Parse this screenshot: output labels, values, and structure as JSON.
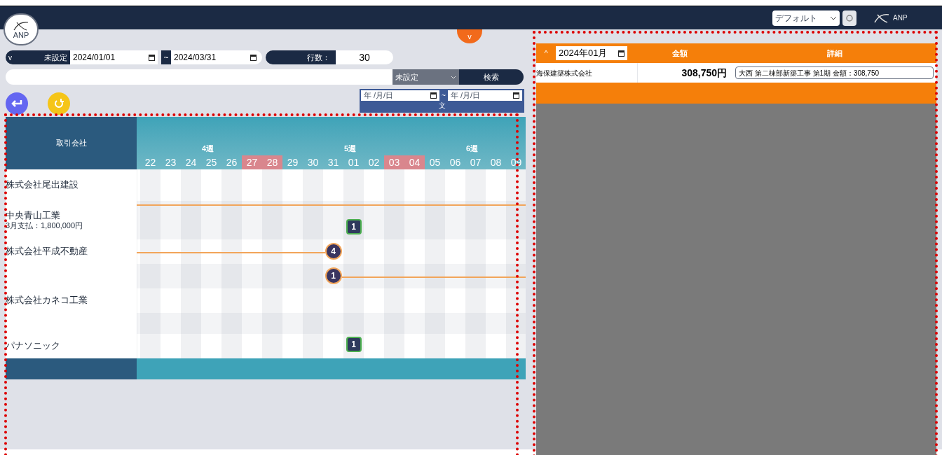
{
  "header": {
    "logo_text": "ANP",
    "menu_toggle": "v",
    "view_select": "デフォルト",
    "brand_text": "ANP"
  },
  "filters": {
    "toggle": "v",
    "status_select": "未設定",
    "date_from": "2024/01/01",
    "range_separator": "~",
    "date_to": "2024/03/31",
    "rows_label": "行数：",
    "rows_value": "30",
    "category_select": "未設定",
    "search_button": "検索",
    "range_from_placeholder": "年 /月/日",
    "range_to_placeholder": "年 /月/日",
    "range_separator_2": "~",
    "range_label": "文"
  },
  "schedule": {
    "company_header": "取引会社",
    "weeks": [
      "4週",
      "5週",
      "6週"
    ],
    "days": [
      {
        "label": "22",
        "holiday": false
      },
      {
        "label": "23",
        "holiday": false
      },
      {
        "label": "24",
        "holiday": false
      },
      {
        "label": "25",
        "holiday": false
      },
      {
        "label": "26",
        "holiday": false
      },
      {
        "label": "27",
        "holiday": true
      },
      {
        "label": "28",
        "holiday": true
      },
      {
        "label": "29",
        "holiday": false
      },
      {
        "label": "30",
        "holiday": false
      },
      {
        "label": "31",
        "holiday": false
      },
      {
        "label": "01",
        "holiday": false
      },
      {
        "label": "02",
        "holiday": false
      },
      {
        "label": "03",
        "holiday": true
      },
      {
        "label": "04",
        "holiday": true
      },
      {
        "label": "05",
        "holiday": false
      },
      {
        "label": "06",
        "holiday": false
      },
      {
        "label": "07",
        "holiday": false
      },
      {
        "label": "08",
        "holiday": false
      },
      {
        "label": "09",
        "holiday": false
      }
    ],
    "rows": [
      {
        "company": "株式会社尾出建設",
        "kind": "plain"
      },
      {
        "company": "中央青山工業",
        "note": "3月支払：1,800,000円",
        "kind": "bar",
        "marker": {
          "kind": "square",
          "label": "1"
        }
      },
      {
        "company": "株式会社平成不動産",
        "kind": "leadin",
        "marker": {
          "kind": "circle",
          "label": "4"
        }
      },
      {
        "kind": "leadout",
        "marker": {
          "kind": "circle",
          "label": "1"
        }
      },
      {
        "company": "株式会社カネコ工業",
        "kind": "plain"
      },
      {
        "kind": "plain"
      },
      {
        "company": "パナソニック",
        "kind": "plain",
        "marker": {
          "kind": "square",
          "label": "1"
        }
      }
    ]
  },
  "payments": {
    "collapse": "^",
    "month": "2024年01月",
    "columns": [
      "金額",
      "詳細"
    ],
    "rows": [
      {
        "company": "海保建築株式会社",
        "amount": "308,750円",
        "detail": "大西 第二棟部新築工事 第1期 金額：308,750"
      }
    ]
  }
}
